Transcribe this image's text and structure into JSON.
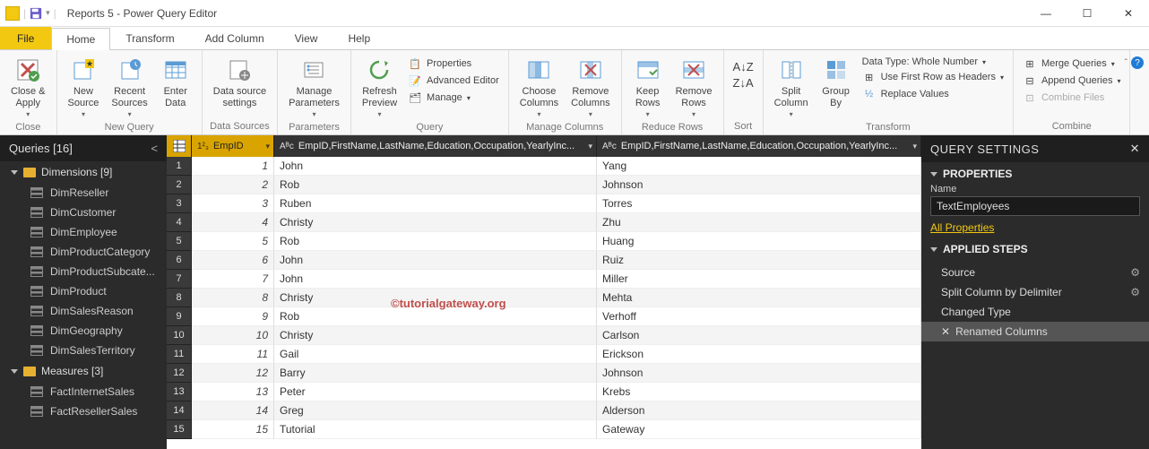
{
  "titlebar": {
    "title": "Reports 5 - Power Query Editor"
  },
  "tabs": {
    "file": "File",
    "home": "Home",
    "transform": "Transform",
    "addcol": "Add Column",
    "view": "View",
    "help": "Help"
  },
  "ribbon": {
    "close_apply": "Close &\nApply",
    "close_group": "Close",
    "new_source": "New\nSource",
    "recent_sources": "Recent\nSources",
    "enter_data": "Enter\nData",
    "new_query_group": "New Query",
    "data_source_settings": "Data source\nsettings",
    "data_sources_group": "Data Sources",
    "manage_parameters": "Manage\nParameters",
    "parameters_group": "Parameters",
    "refresh_preview": "Refresh\nPreview",
    "properties": "Properties",
    "advanced_editor": "Advanced Editor",
    "manage": "Manage",
    "query_group": "Query",
    "choose_columns": "Choose\nColumns",
    "remove_columns": "Remove\nColumns",
    "manage_columns_group": "Manage Columns",
    "keep_rows": "Keep\nRows",
    "remove_rows": "Remove\nRows",
    "reduce_rows_group": "Reduce Rows",
    "sort_group": "Sort",
    "split_column": "Split\nColumn",
    "group_by": "Group\nBy",
    "data_type": "Data Type: Whole Number",
    "first_row_headers": "Use First Row as Headers",
    "replace_values": "Replace Values",
    "transform_group": "Transform",
    "merge_queries": "Merge Queries",
    "append_queries": "Append Queries",
    "combine_files": "Combine Files",
    "combine_group": "Combine"
  },
  "queries": {
    "title": "Queries [16]",
    "groups": [
      {
        "name": "Dimensions [9]",
        "items": [
          "DimReseller",
          "DimCustomer",
          "DimEmployee",
          "DimProductCategory",
          "DimProductSubcate...",
          "DimProduct",
          "DimSalesReason",
          "DimGeography",
          "DimSalesTerritory"
        ]
      },
      {
        "name": "Measures [3]",
        "items": [
          "FactInternetSales",
          "FactResellerSales"
        ]
      }
    ]
  },
  "grid": {
    "cols": {
      "id": "EmpID",
      "c1": "EmpID,FirstName,LastName,Education,Occupation,YearlyInc...",
      "c2": "EmpID,FirstName,LastName,Education,Occupation,YearlyInc..."
    },
    "rows": [
      {
        "n": 1,
        "id": "1",
        "a": "John",
        "b": "Yang"
      },
      {
        "n": 2,
        "id": "2",
        "a": "Rob",
        "b": "Johnson"
      },
      {
        "n": 3,
        "id": "3",
        "a": "Ruben",
        "b": "Torres"
      },
      {
        "n": 4,
        "id": "4",
        "a": "Christy",
        "b": "Zhu"
      },
      {
        "n": 5,
        "id": "5",
        "a": "Rob",
        "b": "Huang"
      },
      {
        "n": 6,
        "id": "6",
        "a": "John",
        "b": "Ruiz"
      },
      {
        "n": 7,
        "id": "7",
        "a": "John",
        "b": "Miller"
      },
      {
        "n": 8,
        "id": "8",
        "a": "Christy",
        "b": "Mehta"
      },
      {
        "n": 9,
        "id": "9",
        "a": "Rob",
        "b": "Verhoff"
      },
      {
        "n": 10,
        "id": "10",
        "a": "Christy",
        "b": "Carlson"
      },
      {
        "n": 11,
        "id": "11",
        "a": "Gail",
        "b": "Erickson"
      },
      {
        "n": 12,
        "id": "12",
        "a": "Barry",
        "b": "Johnson"
      },
      {
        "n": 13,
        "id": "13",
        "a": "Peter",
        "b": "Krebs"
      },
      {
        "n": 14,
        "id": "14",
        "a": "Greg",
        "b": "Alderson"
      },
      {
        "n": 15,
        "id": "15",
        "a": "Tutorial",
        "b": "Gateway"
      }
    ]
  },
  "watermark": "©tutorialgateway.org",
  "settings": {
    "title": "QUERY SETTINGS",
    "properties": "PROPERTIES",
    "name_label": "Name",
    "name_value": "TextEmployees",
    "all_properties": "All Properties",
    "applied_steps": "APPLIED STEPS",
    "steps": [
      {
        "label": "Source",
        "gear": true
      },
      {
        "label": "Split Column by Delimiter",
        "gear": true
      },
      {
        "label": "Changed Type",
        "gear": false
      },
      {
        "label": "Renamed Columns",
        "gear": false,
        "sel": true
      }
    ]
  }
}
